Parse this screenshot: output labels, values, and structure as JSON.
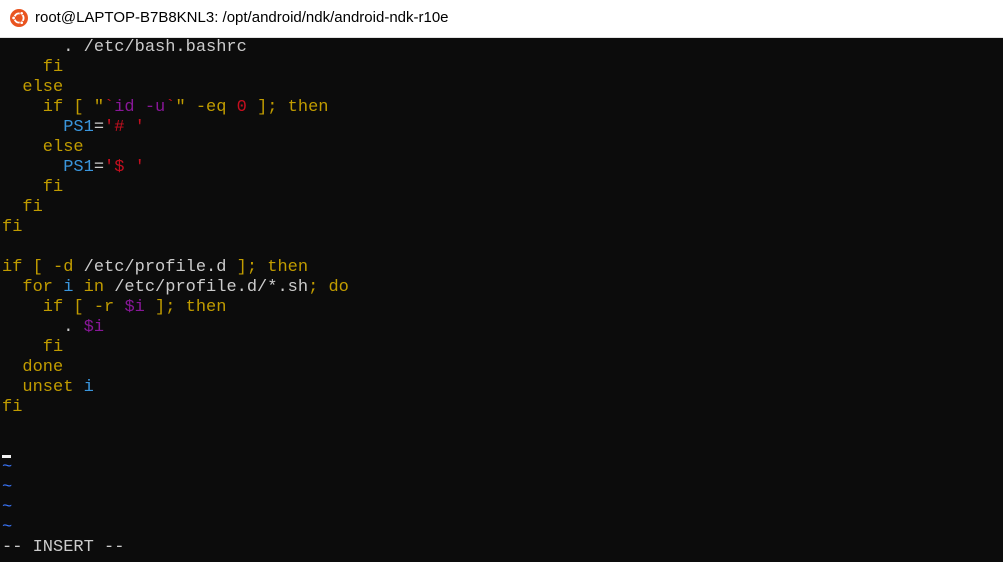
{
  "window": {
    "title": "root@LAPTOP-B7B8KNL3: /opt/android/ndk/android-ndk-r10e",
    "icon": "ubuntu-icon"
  },
  "colors": {
    "background": "#0c0c0c",
    "keyword": "#c19c00",
    "string": "#c50f1f",
    "variable": "#881798",
    "identifier": "#3a96dd",
    "text": "#cccccc",
    "tilde": "#3b78ff"
  },
  "editor": {
    "mode": "-- INSERT --",
    "lines": [
      [
        [
          "      . /etc/bash.bashrc",
          "#cccccc"
        ]
      ],
      [
        [
          "    fi",
          "#c19c00"
        ]
      ],
      [
        [
          "  else",
          "#c19c00"
        ]
      ],
      [
        [
          "    if",
          "#c19c00"
        ],
        [
          " [ \"",
          "#c19c00"
        ],
        [
          "`",
          "#c50f1f"
        ],
        [
          "id -u",
          "#881798"
        ],
        [
          "`",
          "#c50f1f"
        ],
        [
          "\" -eq ",
          "#c19c00"
        ],
        [
          "0",
          "#c50f1f"
        ],
        [
          " ]; then",
          "#c19c00"
        ]
      ],
      [
        [
          "      ",
          "#cccccc"
        ],
        [
          "PS1",
          "#3a96dd"
        ],
        [
          "=",
          "#cccccc"
        ],
        [
          "'# '",
          "#c50f1f"
        ]
      ],
      [
        [
          "    else",
          "#c19c00"
        ]
      ],
      [
        [
          "      ",
          "#cccccc"
        ],
        [
          "PS1",
          "#3a96dd"
        ],
        [
          "=",
          "#cccccc"
        ],
        [
          "'$ '",
          "#c50f1f"
        ]
      ],
      [
        [
          "    fi",
          "#c19c00"
        ]
      ],
      [
        [
          "  fi",
          "#c19c00"
        ]
      ],
      [
        [
          "fi",
          "#c19c00"
        ]
      ],
      [
        [
          "",
          "#cccccc"
        ]
      ],
      [
        [
          "if",
          "#c19c00"
        ],
        [
          " [ -d ",
          "#c19c00"
        ],
        [
          "/etc/profile.d",
          "#cccccc"
        ],
        [
          " ]; then",
          "#c19c00"
        ]
      ],
      [
        [
          "  for",
          "#c19c00"
        ],
        [
          " ",
          "#cccccc"
        ],
        [
          "i",
          "#3a96dd"
        ],
        [
          " in ",
          "#c19c00"
        ],
        [
          "/etc/profile.d/*.sh",
          "#cccccc"
        ],
        [
          "; do",
          "#c19c00"
        ]
      ],
      [
        [
          "    if",
          "#c19c00"
        ],
        [
          " [ -r ",
          "#c19c00"
        ],
        [
          "$i",
          "#881798"
        ],
        [
          " ]; then",
          "#c19c00"
        ]
      ],
      [
        [
          "      . ",
          "#cccccc"
        ],
        [
          "$i",
          "#881798"
        ]
      ],
      [
        [
          "    fi",
          "#c19c00"
        ]
      ],
      [
        [
          "  done",
          "#c19c00"
        ]
      ],
      [
        [
          "  unset ",
          "#c19c00"
        ],
        [
          "i",
          "#3a96dd"
        ]
      ],
      [
        [
          "fi",
          "#c19c00"
        ]
      ]
    ],
    "tildes": [
      "~",
      "~",
      "~",
      "~"
    ]
  }
}
